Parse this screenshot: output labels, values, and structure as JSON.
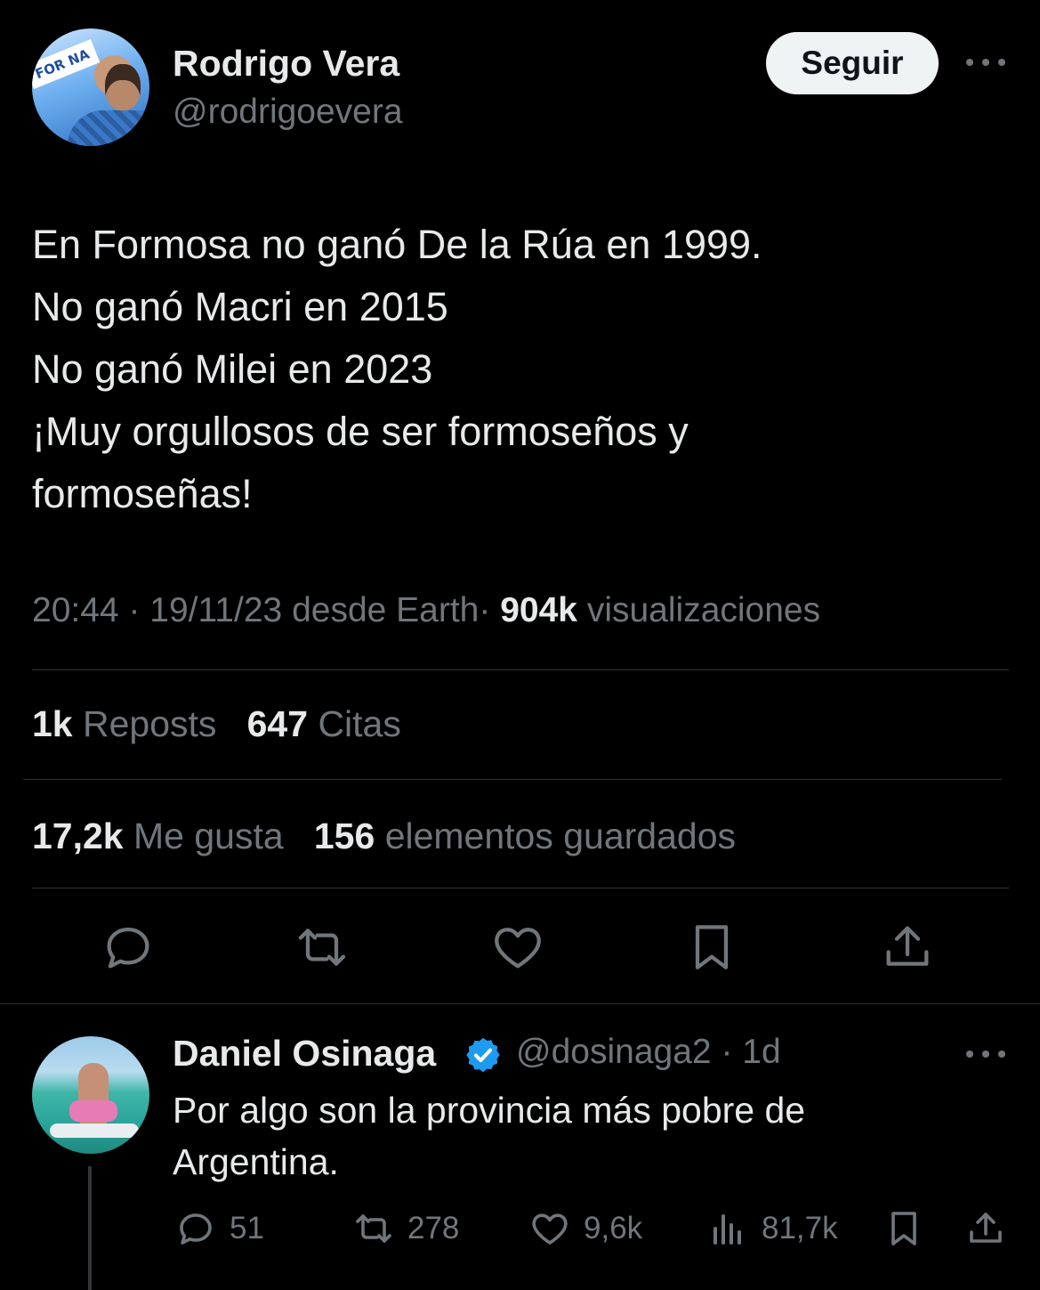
{
  "tweet": {
    "author_name": "Rodrigo Vera",
    "author_handle": "@rodrigoevera",
    "avatar_banner_text": "FOR NA",
    "follow_label": "Seguir",
    "text_lines": [
      "En Formosa no ganó De la Rúa en 1999.",
      "No ganó Macri en 2015",
      "No ganó Milei en 2023",
      "¡Muy orgullosos de ser formoseños y",
      "formoseñas!"
    ],
    "time": "20:44",
    "date": "19/11/23",
    "source": "desde Earth",
    "sep": "·",
    "views_count": "904k",
    "views_label": "visualizaciones",
    "reposts_count": "1k",
    "reposts_label": "Reposts",
    "quotes_count": "647",
    "quotes_label": "Citas",
    "likes_count": "17,2k",
    "likes_label": "Me gusta",
    "bookmarks_count": "156",
    "bookmarks_label": "elementos guardados"
  },
  "reply": {
    "author_name": "Daniel Osinaga",
    "author_handle": "@dosinaga2",
    "sep": "·",
    "age": "1d",
    "text": "Por algo son la provincia más pobre de Argentina.",
    "replies": "51",
    "reposts": "278",
    "likes": "9,6k",
    "views": "81,7k"
  },
  "colors": {
    "background": "#000000",
    "text_primary": "#e7e9ea",
    "text_secondary": "#71767b",
    "divider": "#2f3336",
    "verified_blue": "#1d9bf0"
  }
}
